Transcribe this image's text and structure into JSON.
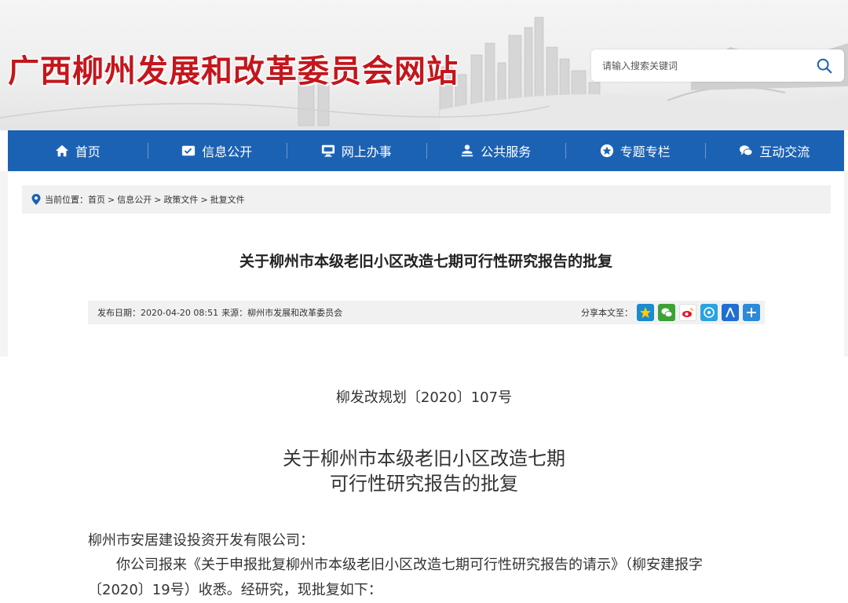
{
  "header": {
    "site_title": "广西柳州发展和改革委员会网站",
    "search_placeholder": "请输入搜索关键词"
  },
  "nav": {
    "items": [
      {
        "label": "首页",
        "icon": "home-icon"
      },
      {
        "label": "信息公开",
        "icon": "info-card-icon"
      },
      {
        "label": "网上办事",
        "icon": "monitor-icon"
      },
      {
        "label": "公共服务",
        "icon": "service-icon"
      },
      {
        "label": "专题专栏",
        "icon": "star-badge-icon"
      },
      {
        "label": "互动交流",
        "icon": "chat-icon"
      }
    ]
  },
  "breadcrumb": {
    "prefix": "当前位置：",
    "items": [
      "首页",
      "信息公开",
      "政策文件",
      "批复文件"
    ],
    "separator": ">"
  },
  "article": {
    "title": "关于柳州市本级老旧小区改造七期可行性研究报告的批复",
    "date_label": "发布日期：",
    "date": "2020-04-20 08:51",
    "source_label": "来源：",
    "source": "柳州市发展和改革委员会",
    "share_label": "分享本文至："
  },
  "share_icons": [
    {
      "name": "qzone-share-icon",
      "color": "#1a8ad1"
    },
    {
      "name": "wechat-share-icon",
      "color": "#3ba234"
    },
    {
      "name": "weibo-share-icon",
      "color": "#e6162d"
    },
    {
      "name": "tencent-weibo-share-icon",
      "color": "#2aa3e0"
    },
    {
      "name": "renren-share-icon",
      "color": "#1f6fd1"
    },
    {
      "name": "more-share-icon",
      "color": "#2d8ad8"
    }
  ],
  "document": {
    "number": "柳发改规划〔2020〕107号",
    "title_line1": "关于柳州市本级老旧小区改造七期",
    "title_line2": "可行性研究报告的批复",
    "recipient": "柳州市安居建设投资开发有限公司：",
    "paragraph1": "你公司报来《关于申报批复柳州市本级老旧小区改造七期可行性研究报告的请示》（柳安建报字〔2020〕19号）收悉。经研究，现批复如下："
  },
  "colors": {
    "brand_red": "#c4161c",
    "nav_blue": "#1c62b4"
  }
}
